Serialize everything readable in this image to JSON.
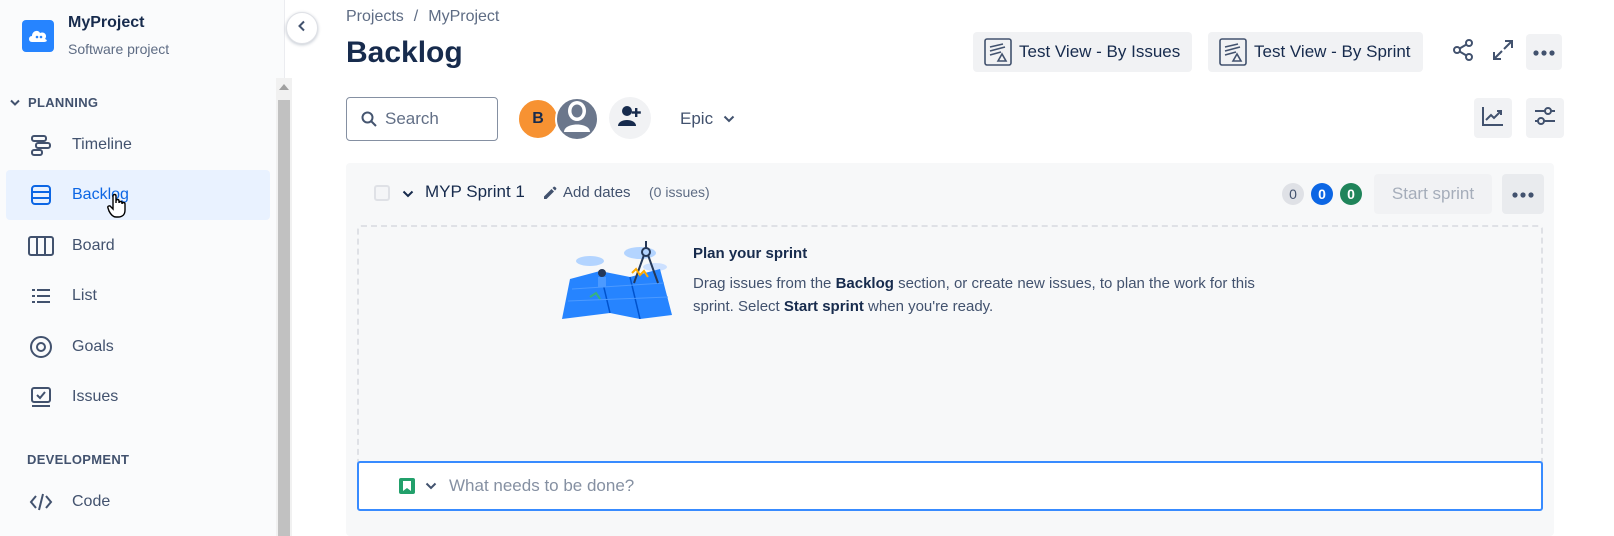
{
  "project": {
    "name": "MyProject",
    "type": "Software project"
  },
  "sidebar": {
    "planning_title": "PLANNING",
    "planning_items": [
      {
        "label": "Timeline",
        "icon": "timeline-icon"
      },
      {
        "label": "Backlog",
        "icon": "backlog-icon",
        "active": true
      },
      {
        "label": "Board",
        "icon": "board-icon"
      },
      {
        "label": "List",
        "icon": "list-icon"
      },
      {
        "label": "Goals",
        "icon": "goals-icon"
      },
      {
        "label": "Issues",
        "icon": "issues-icon"
      }
    ],
    "development_title": "DEVELOPMENT",
    "development_items": [
      {
        "label": "Code",
        "icon": "code-icon"
      }
    ]
  },
  "breadcrumb": {
    "root": "Projects",
    "separator": "/",
    "current": "MyProject"
  },
  "page": {
    "title": "Backlog"
  },
  "header_actions": {
    "view1": "Test View - By Issues",
    "view2": "Test View - By Sprint"
  },
  "toolbar": {
    "search_placeholder": "Search",
    "avatar_initial": "B",
    "epic_label": "Epic"
  },
  "sprint": {
    "name": "MYP Sprint 1",
    "add_dates": "Add dates",
    "issue_count": "(0 issues)",
    "counts": {
      "todo": "0",
      "in_progress": "0",
      "done": "0"
    },
    "start_button": "Start sprint",
    "empty_title": "Plan your sprint",
    "empty_desc_1": "Drag issues from the ",
    "empty_desc_bold1": "Backlog",
    "empty_desc_2": " section, or create new issues, to plan the work for this sprint. Select ",
    "empty_desc_bold2": "Start sprint",
    "empty_desc_3": " when you're ready.",
    "create_placeholder": "What needs to be done?"
  },
  "colors": {
    "accent": "#0c66e4",
    "avatar": "#f79232",
    "done": "#1f845a",
    "story": "#22a06b"
  }
}
